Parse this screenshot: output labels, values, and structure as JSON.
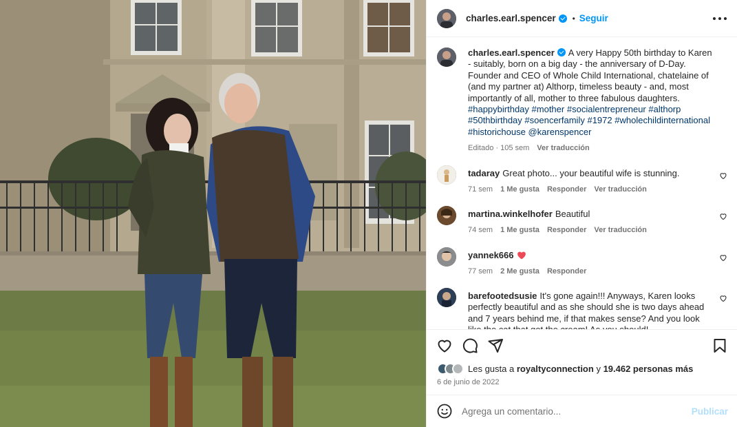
{
  "post": {
    "username": "charles.earl.spencer",
    "follow_label": "Seguir",
    "separator": "•"
  },
  "caption": {
    "username": "charles.earl.spencer",
    "text": "A very Happy 50th birthday to Karen - suitably, born on a big day - the anniversary of D-Day. Founder and CEO of Whole Child International, chatelaine of (and my partner at) Althorp, timeless beauty - and, most importantly of all, mother to three fabulous daughters.",
    "tags": [
      "#happybirthday",
      "#mother",
      "#socialentrepreneur",
      "#althorp",
      "#50thbirthday",
      "#soencerfamily",
      "#1972",
      "#wholechildinternational",
      "#historichouse",
      "@karenspencer"
    ],
    "time": "Editado · 105 sem",
    "translate": "Ver traducción"
  },
  "comments": [
    {
      "username": "tadaray",
      "text": "Great photo... your beautiful wife is stunning.",
      "time": "71 sem",
      "likes": "1 Me gusta",
      "reply": "Responder",
      "translate": "Ver traducción"
    },
    {
      "username": "martina.winkelhofer",
      "text": "Beautiful",
      "time": "74 sem",
      "likes": "1 Me gusta",
      "reply": "Responder",
      "translate": "Ver traducción"
    },
    {
      "username": "yannek666",
      "text": "",
      "time": "77 sem",
      "likes": "2 Me gusta",
      "reply": "Responder"
    },
    {
      "username": "barefootedsusie",
      "text": "It's gone again!!! Anyways, Karen looks perfectly beautiful and as she should she is two days ahead and 7 years behind me, if that makes sense? And you look like the cat that got the cream! As you should!"
    }
  ],
  "likes": {
    "prefix": "Les gusta a",
    "user": "royaltyconnection",
    "joiner": "y",
    "others": "19.462 personas más"
  },
  "date": "6 de junio de 2022",
  "comment_box": {
    "placeholder": "Agrega un comentario...",
    "publish_label": "Publicar"
  },
  "colors": {
    "accent": "#0095f6",
    "hashtag": "#00376b",
    "muted": "#737373",
    "heart_red": "#ed4956",
    "publish_disabled": "#b2dffc"
  },
  "icons": [
    "heart-icon",
    "comment-icon",
    "share-icon",
    "bookmark-icon",
    "emoji-icon",
    "more-options-icon",
    "verified-badge-icon"
  ]
}
